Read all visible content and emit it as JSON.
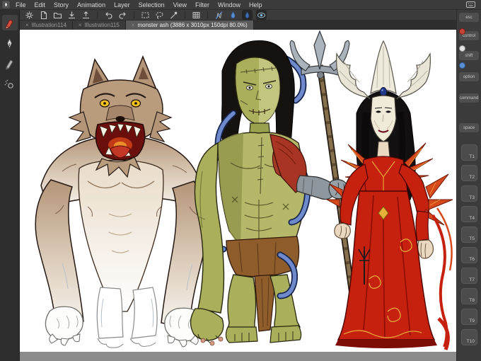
{
  "menubar": {
    "items": [
      "File",
      "Edit",
      "Story",
      "Animation",
      "Layer",
      "Selection",
      "View",
      "Filter",
      "Window",
      "Help"
    ]
  },
  "tabs": {
    "close_glyph": "×",
    "items": [
      {
        "label": "Illustration114",
        "active": false
      },
      {
        "label": "Illustration115",
        "active": false
      },
      {
        "label": "monster ash (3886 x 3010px 150dpi 80.0%)",
        "active": true
      }
    ]
  },
  "toolbar": {
    "letter_glyph": "N",
    "icon_names": [
      "gear-icon",
      "new-file-icon",
      "open-folder-icon",
      "save-icon",
      "export-icon",
      "undo-icon",
      "redo-icon",
      "select-rect-icon",
      "lasso-icon",
      "magic-wand-icon",
      "grid-icon",
      "letter-n-icon",
      "water-droplet-icon",
      "blend-droplet-icon",
      "visibility-icon"
    ]
  },
  "tool_strip": {
    "icon_names": [
      "marker-tool-icon",
      "pen-tool-icon",
      "pencil-tool-icon",
      "airbrush-tool-icon"
    ]
  },
  "sidebar_indicators": {
    "icon_names": [
      "red-color-indicator",
      "white-color-indicator",
      "blue-color-indicator"
    ]
  },
  "edge_keyboard": {
    "modifier_keys": [
      "esc",
      "control",
      "shift",
      "option",
      "command",
      "space"
    ],
    "tab_keys": [
      "T1",
      "T2",
      "T3",
      "T4",
      "T5",
      "T6",
      "T7",
      "T8",
      "T9",
      "T10"
    ]
  },
  "canvas": {
    "figures": [
      "werewolf",
      "stitched-monster-with-trident",
      "vampire-queen"
    ]
  },
  "colors": {
    "menubar_bg": "#3b3b3b",
    "strip_bg": "#2e2e2e",
    "active_tab_bg": "#5a5a5a",
    "workspace_bg": "#8b8b8b",
    "canvas_bg": "#ffffff",
    "accent_blue": "#5a8fd4"
  }
}
